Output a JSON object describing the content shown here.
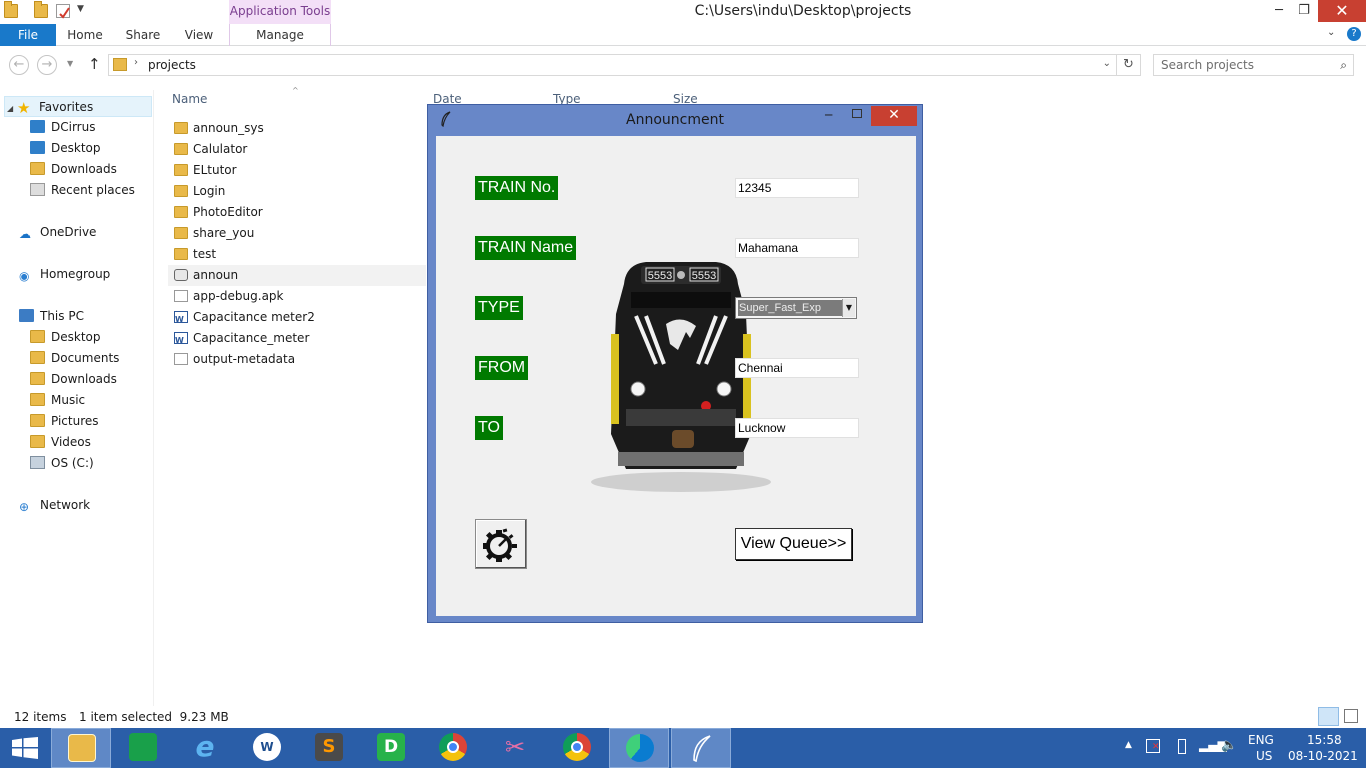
{
  "explorer": {
    "window_title": "C:\\Users\\indu\\Desktop\\projects",
    "contextual_tab": "Application Tools",
    "ribbon_tabs": [
      "File",
      "Home",
      "Share",
      "View",
      "Manage"
    ],
    "address": "projects",
    "search_placeholder": "Search projects",
    "columns": [
      "Name",
      "Date modified",
      "Type",
      "Size"
    ],
    "nav": {
      "favorites": "Favorites",
      "favorites_items": [
        "DCirrus",
        "Desktop",
        "Downloads",
        "Recent places"
      ],
      "onedrive": "OneDrive",
      "homegroup": "Homegroup",
      "thispc": "This PC",
      "thispc_items": [
        "Desktop",
        "Documents",
        "Downloads",
        "Music",
        "Pictures",
        "Videos",
        "OS (C:)"
      ],
      "network": "Network"
    },
    "files": [
      {
        "name": "announ_sys",
        "icon": "folder-icon"
      },
      {
        "name": "Calulator",
        "icon": "folder-icon"
      },
      {
        "name": "ELtutor",
        "icon": "folder-icon"
      },
      {
        "name": "Login",
        "icon": "folder-icon"
      },
      {
        "name": "PhotoEditor",
        "icon": "folder-icon"
      },
      {
        "name": "share_you",
        "icon": "folder-icon"
      },
      {
        "name": "test",
        "icon": "folder-icon"
      },
      {
        "name": "announ",
        "icon": "python-file-icon"
      },
      {
        "name": "app-debug.apk",
        "icon": "file-icon"
      },
      {
        "name": "Capacitance meter2",
        "icon": "word-doc-icon"
      },
      {
        "name": "Capacitance_meter",
        "icon": "word-doc-icon"
      },
      {
        "name": "output-metadata",
        "icon": "json-file-icon"
      }
    ],
    "status": {
      "item_count": "12 items",
      "selection": "1 item selected  9.23 MB"
    }
  },
  "dialog": {
    "title": "Announcment",
    "labels": {
      "train_no": "TRAIN No.",
      "train_name": "TRAIN Name",
      "type": "TYPE",
      "from": "FROM",
      "to": "TO"
    },
    "values": {
      "train_no": "12345",
      "train_name": "Mahamana",
      "type": "Super_Fast_Exp",
      "from": "Chennai",
      "to": "Lucknow"
    },
    "locomotive_number": "5553",
    "view_queue_label": "View Queue>>"
  },
  "taskbar": {
    "lang_top": "ENG",
    "lang_bottom": "US",
    "time": "15:58",
    "date": "08-10-2021"
  },
  "colors": {
    "label_green": "#007a00",
    "dialog_frame": "#6887c8",
    "taskbar": "#2a5ea8",
    "file_tab": "#1979ca",
    "close_red": "#c84031"
  }
}
